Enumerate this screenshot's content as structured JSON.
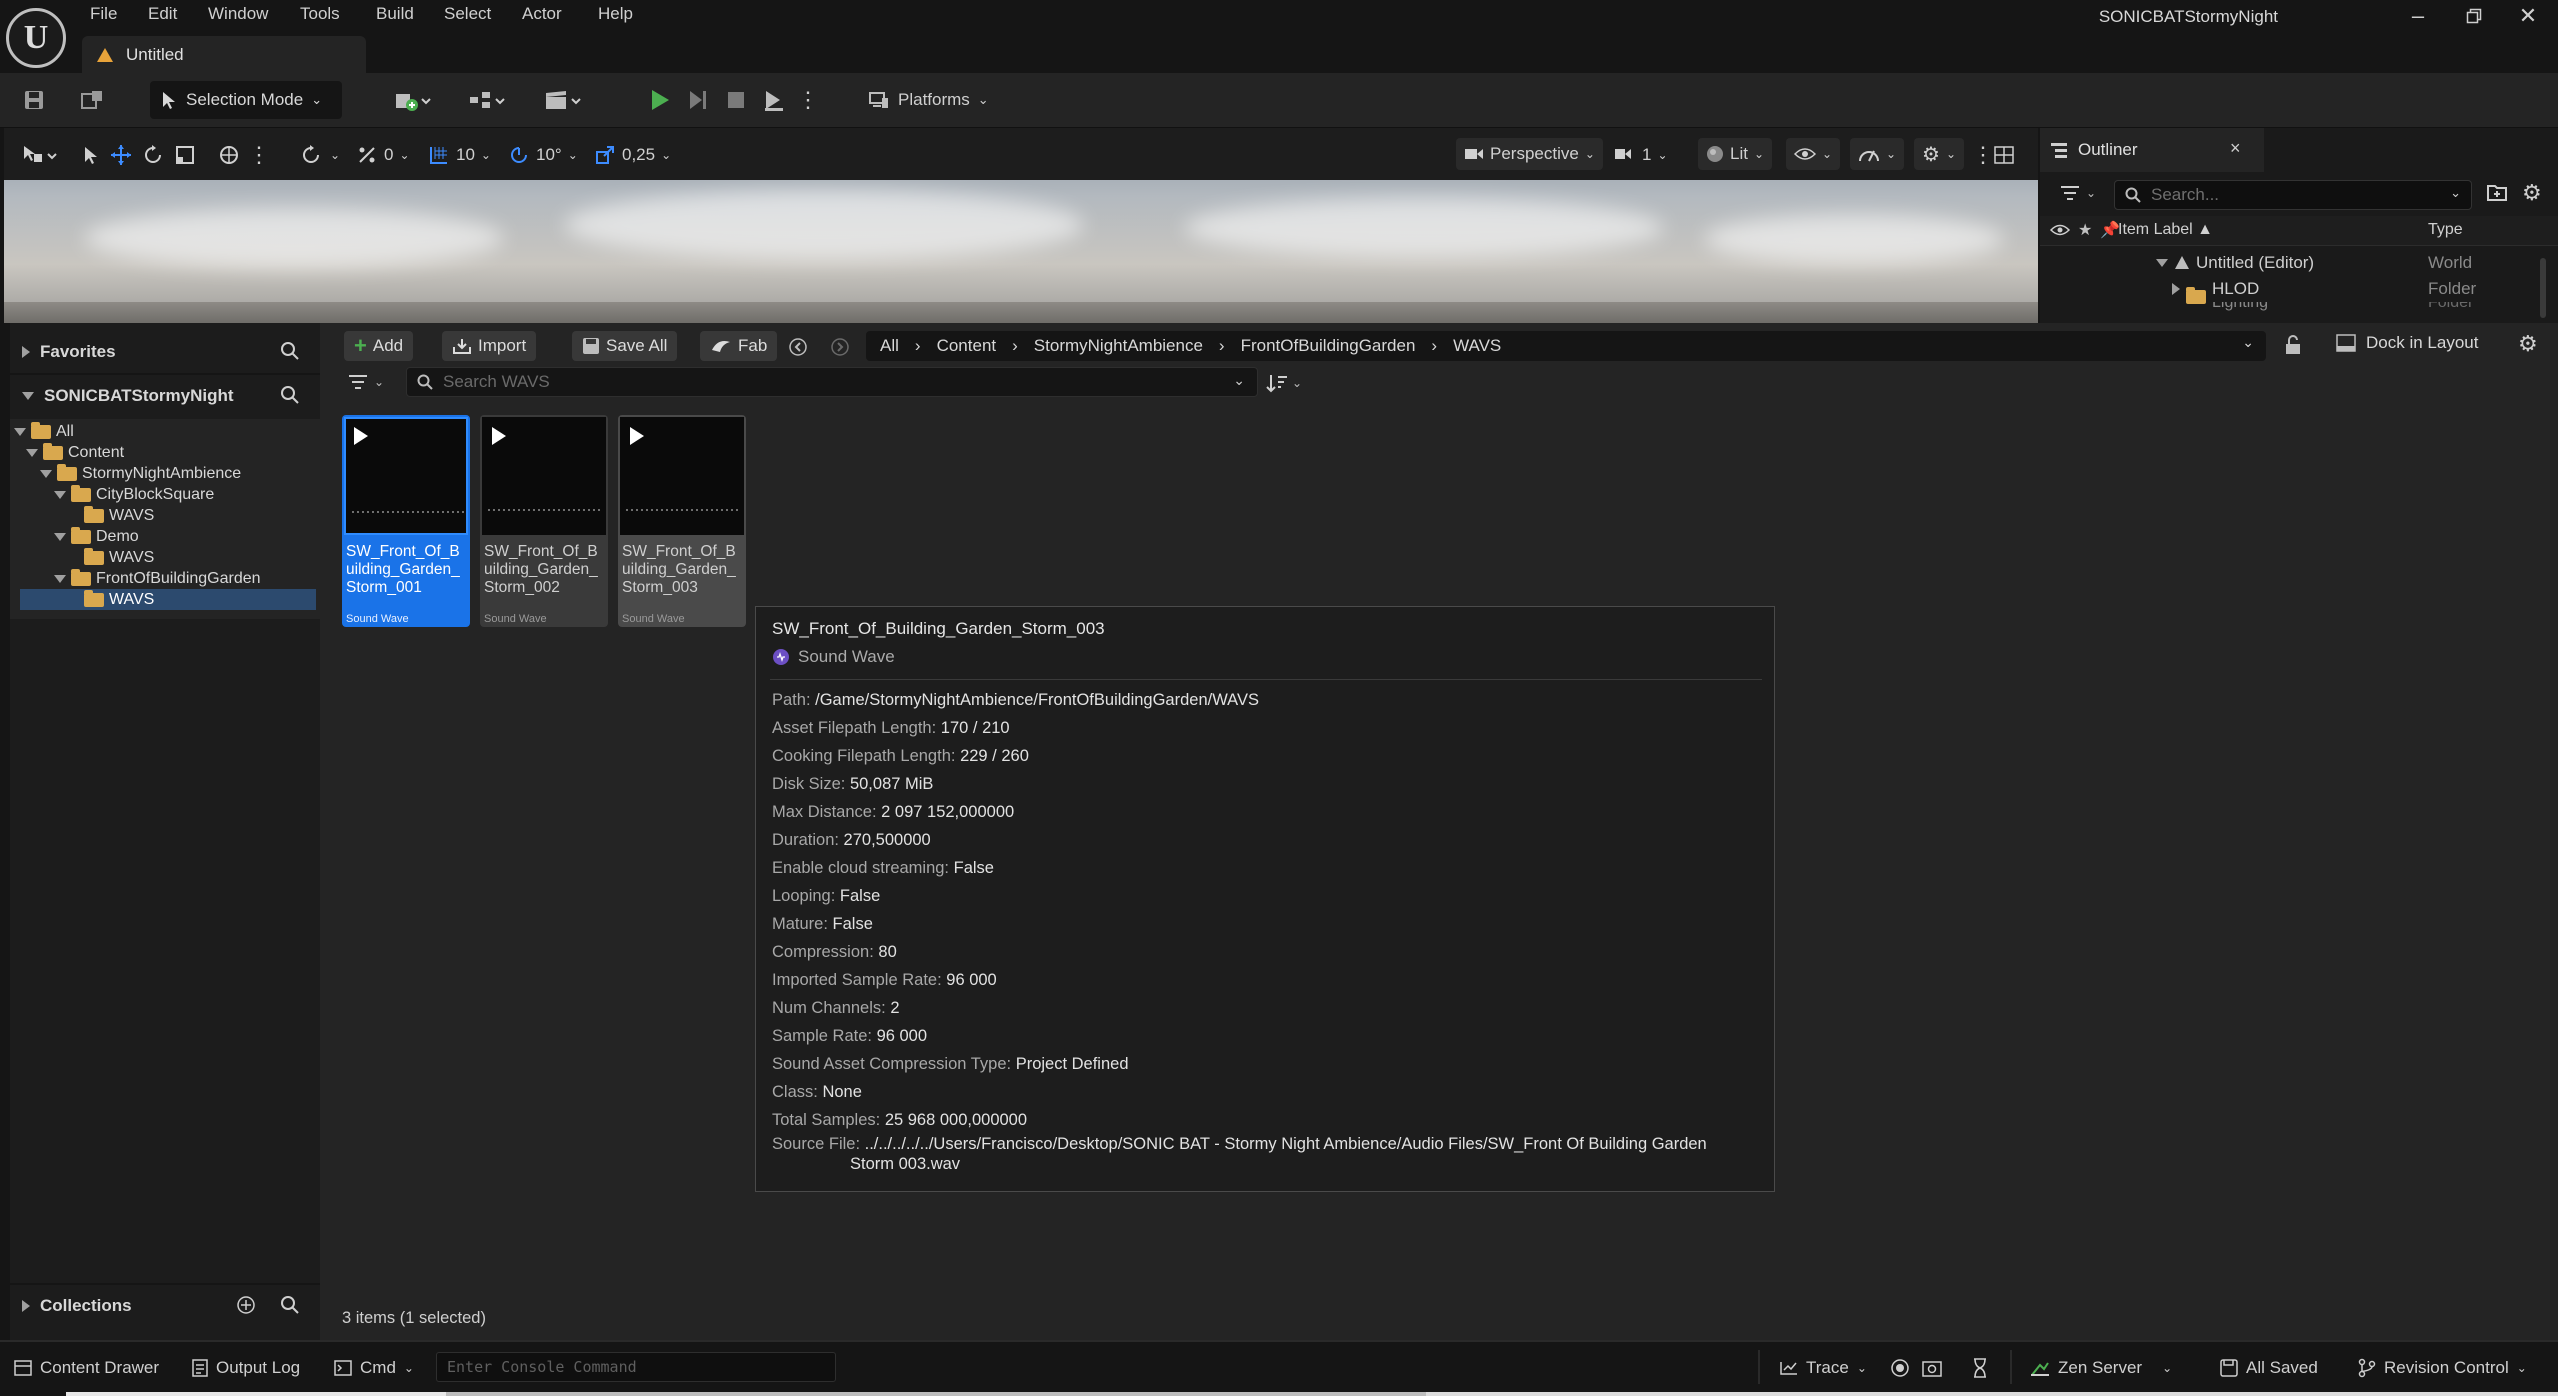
{
  "menu": [
    "File",
    "Edit",
    "Window",
    "Tools",
    "Build",
    "Select",
    "Actor",
    "Help"
  ],
  "document_tab": "Untitled",
  "project_name": "SONICBATStormyNight",
  "toolbar": {
    "selection_mode": "Selection Mode",
    "platforms": "Platforms"
  },
  "viewport_toolbar": {
    "rotation_snap": "0",
    "grid_snap": "10",
    "angle_snap": "10°",
    "scale_snap": "0,25",
    "perspective": "Perspective",
    "camera_speed": "1",
    "lit": "Lit"
  },
  "outliner": {
    "tab_label": "Outliner",
    "search_placeholder": "Search...",
    "col_label": "Item Label ▲",
    "col_type": "Type",
    "rows": [
      {
        "label": "Untitled (Editor)",
        "type": "World"
      },
      {
        "label": "HLOD",
        "type": "Folder"
      },
      {
        "label": "Lighting",
        "type": "Folder"
      }
    ]
  },
  "content_browser": {
    "favorites": "Favorites",
    "project_root": "SONICBATStormyNight",
    "collections": "Collections",
    "buttons": {
      "add": "Add",
      "import": "Import",
      "save_all": "Save All",
      "fab": "Fab"
    },
    "breadcrumb": [
      "All",
      "Content",
      "StormyNightAmbience",
      "FrontOfBuildingGarden",
      "WAVS"
    ],
    "dock_in_layout": "Dock in Layout",
    "search_placeholder": "Search WAVS",
    "tree": [
      {
        "label": "All"
      },
      {
        "label": "Content"
      },
      {
        "label": "StormyNightAmbience"
      },
      {
        "label": "CityBlockSquare"
      },
      {
        "label": "WAVS"
      },
      {
        "label": "Demo"
      },
      {
        "label": "WAVS"
      },
      {
        "label": "FrontOfBuildingGarden"
      },
      {
        "label": "WAVS"
      }
    ],
    "assets": [
      {
        "name": "SW_Front_Of_Building_Garden_Storm_001",
        "type": "Sound Wave"
      },
      {
        "name": "SW_Front_Of_Building_Garden_Storm_002",
        "type": "Sound Wave"
      },
      {
        "name": "SW_Front_Of_Building_Garden_Storm_003",
        "type": "Sound Wave"
      }
    ],
    "status": "3 items (1 selected)"
  },
  "tooltip": {
    "title": "SW_Front_Of_Building_Garden_Storm_003",
    "type": "Sound Wave",
    "properties": [
      {
        "k": "Path:",
        "v": "/Game/StormyNightAmbience/FrontOfBuildingGarden/WAVS"
      },
      {
        "k": "Asset Filepath Length:",
        "v": "170 / 210"
      },
      {
        "k": "Cooking Filepath Length:",
        "v": "229 / 260"
      },
      {
        "k": "Disk Size:",
        "v": "50,087 MiB"
      },
      {
        "k": "Max Distance:",
        "v": "2 097 152,000000"
      },
      {
        "k": "Duration:",
        "v": "270,500000"
      },
      {
        "k": "Enable cloud streaming:",
        "v": "False"
      },
      {
        "k": "Looping:",
        "v": "False"
      },
      {
        "k": "Mature:",
        "v": "False"
      },
      {
        "k": "Compression:",
        "v": "80"
      },
      {
        "k": "Imported Sample Rate:",
        "v": "96 000"
      },
      {
        "k": "Num Channels:",
        "v": "2"
      },
      {
        "k": "Sample Rate:",
        "v": "96 000"
      },
      {
        "k": "Sound Asset Compression Type:",
        "v": "Project Defined"
      },
      {
        "k": "Class:",
        "v": "None"
      },
      {
        "k": "Total Samples:",
        "v": "25 968 000,000000"
      }
    ],
    "source_file_key": "Source File:",
    "source_file_line1": "../../../../../Users/Francisco/Desktop/SONIC BAT - Stormy Night Ambience/Audio Files/SW_Front Of Building Garden",
    "source_file_line2": "Storm 003.wav"
  },
  "statusbar": {
    "content_drawer": "Content Drawer",
    "output_log": "Output Log",
    "cmd": "Cmd",
    "console_placeholder": "Enter Console Command",
    "trace": "Trace",
    "zen_server": "Zen Server",
    "all_saved": "All Saved",
    "revision_control": "Revision Control"
  },
  "colors": {
    "accent": "#1a73e8",
    "play_green": "#4caf50",
    "folder": "#d9a84e"
  }
}
